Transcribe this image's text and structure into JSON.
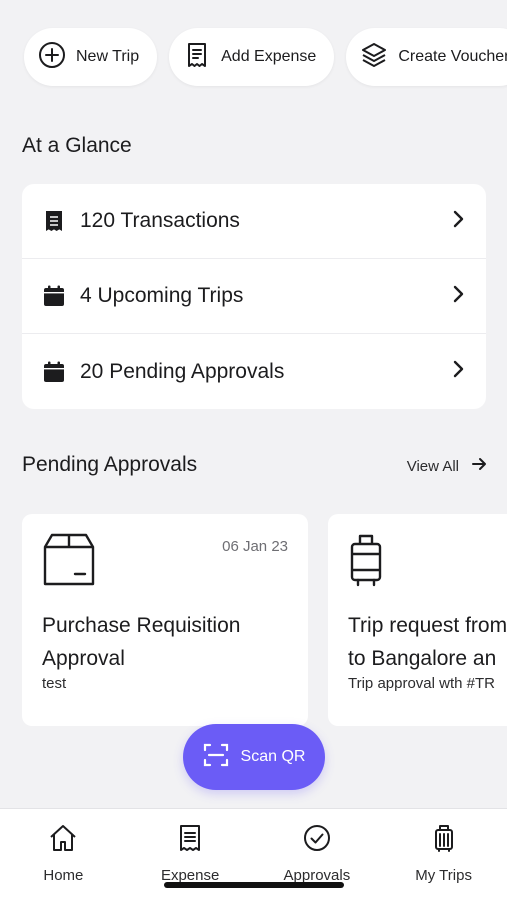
{
  "quick_actions": [
    {
      "label": "New Trip",
      "icon": "plus-circle-icon"
    },
    {
      "label": "Add Expense",
      "icon": "receipt-icon"
    },
    {
      "label": "Create Voucher",
      "icon": "layers-icon"
    }
  ],
  "glance": {
    "title": "At a Glance",
    "items": [
      {
        "label": "120 Transactions",
        "icon": "receipt-filled-icon"
      },
      {
        "label": "4 Upcoming Trips",
        "icon": "calendar-icon"
      },
      {
        "label": "20 Pending Approvals",
        "icon": "calendar-icon"
      }
    ]
  },
  "pending": {
    "title": "Pending Approvals",
    "view_all": "View All",
    "cards": [
      {
        "date": "06 Jan 23",
        "title": "Purchase Requisition Approval",
        "subtitle": "test",
        "icon": "box-icon"
      },
      {
        "title": "Trip request from\nto Bangalore an",
        "subtitle": "Trip approval wth #TR",
        "icon": "luggage-icon"
      }
    ]
  },
  "scan": {
    "label": "Scan QR"
  },
  "nav": [
    {
      "label": "Home",
      "icon": "home-icon"
    },
    {
      "label": "Expense",
      "icon": "receipt-icon"
    },
    {
      "label": "Approvals",
      "icon": "check-circle-icon"
    },
    {
      "label": "My Trips",
      "icon": "luggage-icon"
    }
  ],
  "colors": {
    "accent": "#6b5cf6",
    "background": "#f2f2f4",
    "card": "#ffffff"
  }
}
